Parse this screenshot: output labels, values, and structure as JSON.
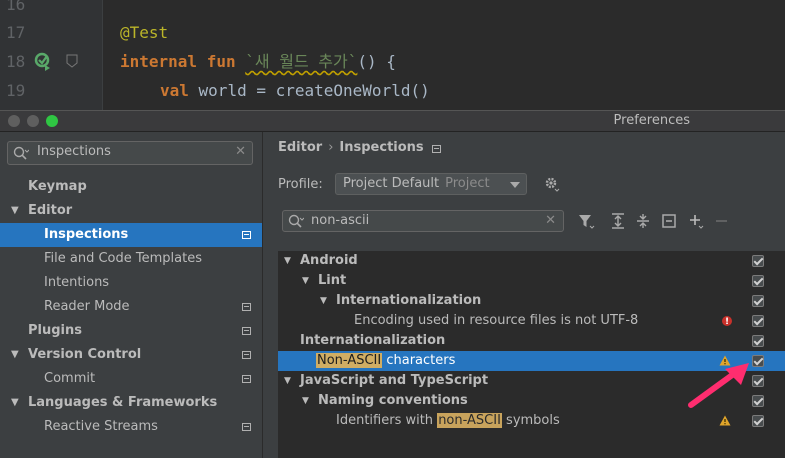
{
  "editor": {
    "lines": [
      {
        "num": "16",
        "code": ""
      },
      {
        "num": "17",
        "annotation": "@Test"
      },
      {
        "num": "18",
        "kw1": "internal",
        "kw2": "fun",
        "fn_name": "`새 월드 추가`",
        "rest": "() {"
      },
      {
        "num": "19",
        "kw": "val",
        "rest": " world = createOneWorld()"
      }
    ]
  },
  "window": {
    "title": "Preferences"
  },
  "left": {
    "search_value": "Inspections",
    "items": [
      {
        "label": "Keymap"
      },
      {
        "label": "Editor"
      },
      {
        "label": "Inspections"
      },
      {
        "label": "File and Code Templates"
      },
      {
        "label": "Intentions"
      },
      {
        "label": "Reader Mode"
      },
      {
        "label": "Plugins"
      },
      {
        "label": "Version Control"
      },
      {
        "label": "Commit"
      },
      {
        "label": "Languages & Frameworks"
      },
      {
        "label": "Reactive Streams"
      }
    ]
  },
  "right": {
    "breadcrumb": {
      "part1": "Editor",
      "sep": "›",
      "part2": "Inspections"
    },
    "profile_label": "Profile:",
    "profile_value": "Project Default",
    "profile_sub": "Project",
    "search_value": "non-ascii",
    "tree": [
      {
        "label": "Android"
      },
      {
        "label": "Lint"
      },
      {
        "label": "Internationalization"
      },
      {
        "label": "Encoding used in resource files is not UTF-8"
      },
      {
        "label": "Internationalization"
      },
      {
        "hl": "Non-ASCII",
        "rest": " characters"
      },
      {
        "label": "JavaScript and TypeScript"
      },
      {
        "label": "Naming conventions"
      },
      {
        "pre": "Identifiers with ",
        "hl": "non-ASCII",
        "rest": " symbols"
      }
    ]
  },
  "colors": {
    "selection": "#2675bf",
    "highlight": "#c8a35c",
    "arrow": "#ff2d6f",
    "error": "#c9312b",
    "warning": "#e0a52b"
  }
}
